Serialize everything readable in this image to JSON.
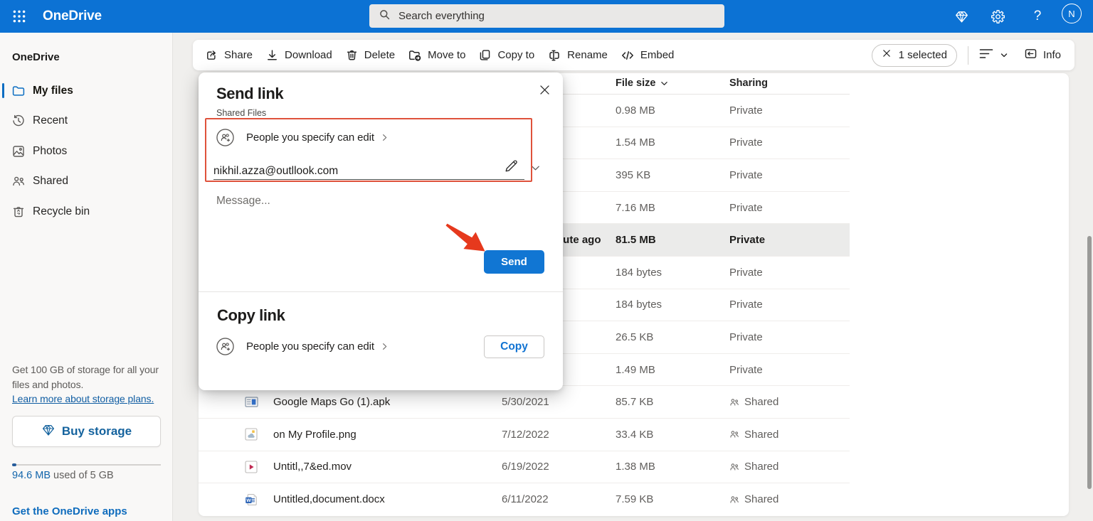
{
  "header": {
    "app_title": "OneDrive",
    "search_placeholder": "Search everything",
    "avatar_initial": "N"
  },
  "sidebar": {
    "title": "OneDrive",
    "items": [
      {
        "id": "my-files",
        "label": "My files",
        "icon": "folder",
        "selected": true
      },
      {
        "id": "recent",
        "label": "Recent",
        "icon": "recent",
        "selected": false
      },
      {
        "id": "photos",
        "label": "Photos",
        "icon": "photos",
        "selected": false
      },
      {
        "id": "shared",
        "label": "Shared",
        "icon": "people",
        "selected": false
      },
      {
        "id": "recycle-bin",
        "label": "Recycle bin",
        "icon": "bin",
        "selected": false
      }
    ],
    "promo_line": "Get 100 GB of storage for all your files and photos.",
    "promo_link": "Learn more about storage plans.",
    "buy_button": "Buy storage",
    "quota_used": "94.6 MB",
    "quota_rest": " used of 5 GB",
    "apps_link": "Get the OneDrive apps"
  },
  "toolbar": {
    "actions": [
      {
        "id": "share",
        "label": "Share"
      },
      {
        "id": "download",
        "label": "Download"
      },
      {
        "id": "delete",
        "label": "Delete"
      },
      {
        "id": "move-to",
        "label": "Move to"
      },
      {
        "id": "copy-to",
        "label": "Copy to"
      },
      {
        "id": "rename",
        "label": "Rename"
      },
      {
        "id": "embed",
        "label": "Embed"
      }
    ],
    "selection_label": "1 selected",
    "info_label": "Info"
  },
  "file_list": {
    "columns": {
      "size": "File size",
      "sharing": "Sharing"
    },
    "rows": [
      {
        "name": "",
        "modified": "",
        "size": "0.98 MB",
        "sharing": "Private",
        "icon": "",
        "selected": false
      },
      {
        "name": "",
        "modified": "",
        "size": "1.54 MB",
        "sharing": "Private",
        "icon": "",
        "selected": false
      },
      {
        "name": "",
        "modified": "",
        "size": "395 KB",
        "sharing": "Private",
        "icon": "",
        "selected": false
      },
      {
        "name": "",
        "modified": "",
        "size": "7.16 MB",
        "sharing": "Private",
        "icon": "",
        "selected": false
      },
      {
        "name": "",
        "modified": "about a minute ago",
        "size": "81.5 MB",
        "sharing": "Private",
        "icon": "",
        "selected": true
      },
      {
        "name": "",
        "modified": "",
        "size": "184 bytes",
        "sharing": "Private",
        "icon": "",
        "selected": false
      },
      {
        "name": "",
        "modified": "",
        "size": "184 bytes",
        "sharing": "Private",
        "icon": "",
        "selected": false
      },
      {
        "name": "",
        "modified": "",
        "size": "26.5 KB",
        "sharing": "Private",
        "icon": "",
        "selected": false
      },
      {
        "name": "",
        "modified": "",
        "size": "1.49 MB",
        "sharing": "Private",
        "icon": "",
        "selected": false
      },
      {
        "name": "Google Maps Go (1).apk",
        "modified": "5/30/2021",
        "size": "85.7 KB",
        "sharing": "Shared",
        "icon": "apk",
        "selected": false
      },
      {
        "name": "on My Profile.png",
        "modified": "7/12/2022",
        "size": "33.4 KB",
        "sharing": "Shared",
        "icon": "image",
        "selected": false
      },
      {
        "name": "Untitl,,7&ed.mov",
        "modified": "6/19/2022",
        "size": "1.38 MB",
        "sharing": "Shared",
        "icon": "video",
        "selected": false
      },
      {
        "name": "Untitled,document.docx",
        "modified": "6/11/2022",
        "size": "7.59 KB",
        "sharing": "Shared",
        "icon": "word",
        "selected": false
      }
    ]
  },
  "dialog": {
    "title": "Send link",
    "subtitle": "Shared Files",
    "permission_label": "People you specify can edit",
    "email": "nikhil.azza@outllook.com",
    "message_placeholder": "Message...",
    "send_label": "Send",
    "copy_title": "Copy link",
    "copy_label": "Copy"
  },
  "colors": {
    "header_blue": "#0c72d4",
    "accent_blue": "#1176d3",
    "annotation_red": "#e6391d"
  }
}
